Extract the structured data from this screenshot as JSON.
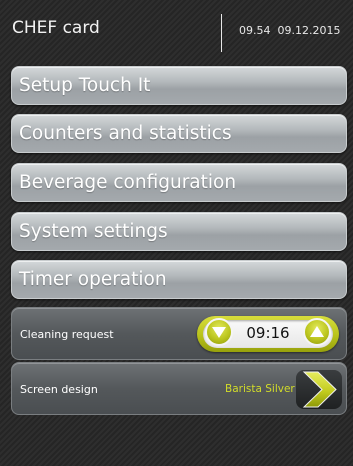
{
  "header": {
    "title": "CHEF card",
    "time": "09.54",
    "date": "09.12.2015"
  },
  "menu": {
    "items": [
      {
        "label": "Setup Touch It"
      },
      {
        "label": "Counters and statistics"
      },
      {
        "label": "Beverage configuration"
      },
      {
        "label": "System settings"
      },
      {
        "label": "Timer operation"
      }
    ]
  },
  "cleaning": {
    "label": "Cleaning request",
    "value": "09:16"
  },
  "screen_design": {
    "label": "Screen design",
    "value": "Barista Silver"
  },
  "colors": {
    "accent": "#c4cd1e",
    "button_silver": "#b3b8bb",
    "background": "#2a2a2a"
  },
  "icons": {
    "decrease": "chevron-down-icon",
    "increase": "chevron-up-icon",
    "next": "chevron-right-icon"
  }
}
